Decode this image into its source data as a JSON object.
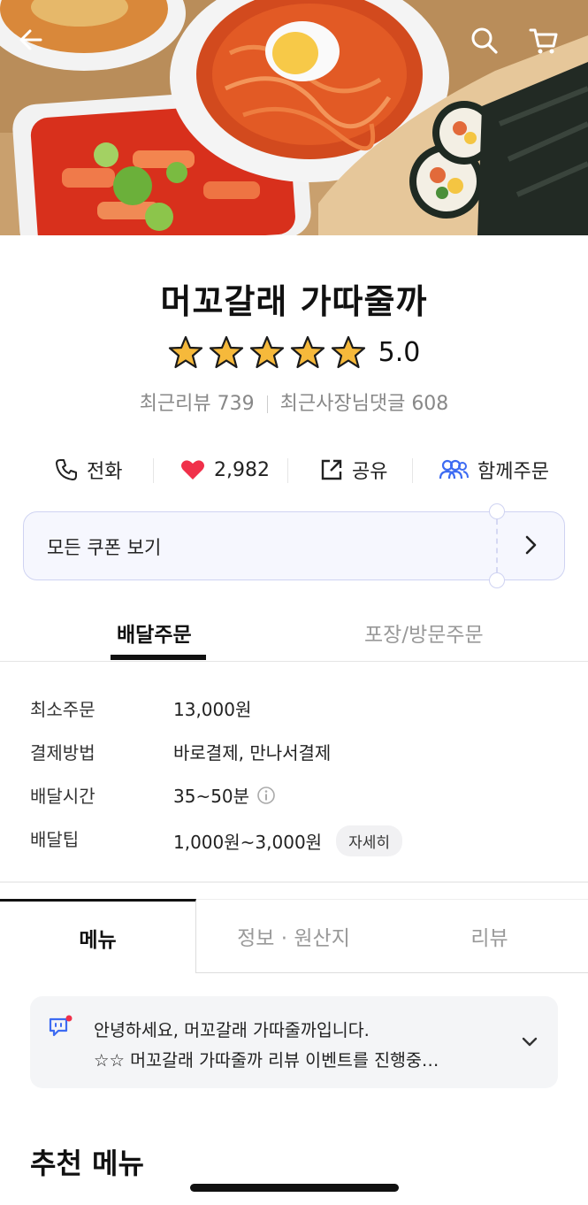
{
  "store": {
    "name": "머꼬갈래 가따줄까",
    "rating": "5.0",
    "rating_stars": 5,
    "recent_reviews": "최근리뷰 739",
    "owner_replies": "최근사장님댓글 608"
  },
  "actions": {
    "call": "전화",
    "likes": "2,982",
    "share": "공유",
    "group_order": "함께주문"
  },
  "coupon": {
    "label": "모든 쿠폰 보기"
  },
  "order_tabs": {
    "delivery": "배달주문",
    "pickup": "포장/방문주문"
  },
  "delivery_info": [
    {
      "label": "최소주문",
      "value": "13,000원"
    },
    {
      "label": "결제방법",
      "value": "바로결제, 만나서결제"
    },
    {
      "label": "배달시간",
      "value": "35~50분"
    },
    {
      "label": "배달팁",
      "value": "1,000원~3,000원",
      "badge": "자세히"
    }
  ],
  "menu_tabs": {
    "menu": "메뉴",
    "info": "정보 · 원산지",
    "review": "리뷰"
  },
  "notice": {
    "line1": "안녕하세요, 머꼬갈래 가따줄까입니다.",
    "line2": "☆☆ 머꼬갈래 가따줄까 리뷰 이벤트를 진행중…"
  },
  "section": {
    "recommended": "추천 메뉴"
  },
  "colors": {
    "star": "#f6b93b",
    "heart": "#f0304a",
    "accent": "#3d6bf2",
    "coupon_bg": "#f6f7fe"
  }
}
